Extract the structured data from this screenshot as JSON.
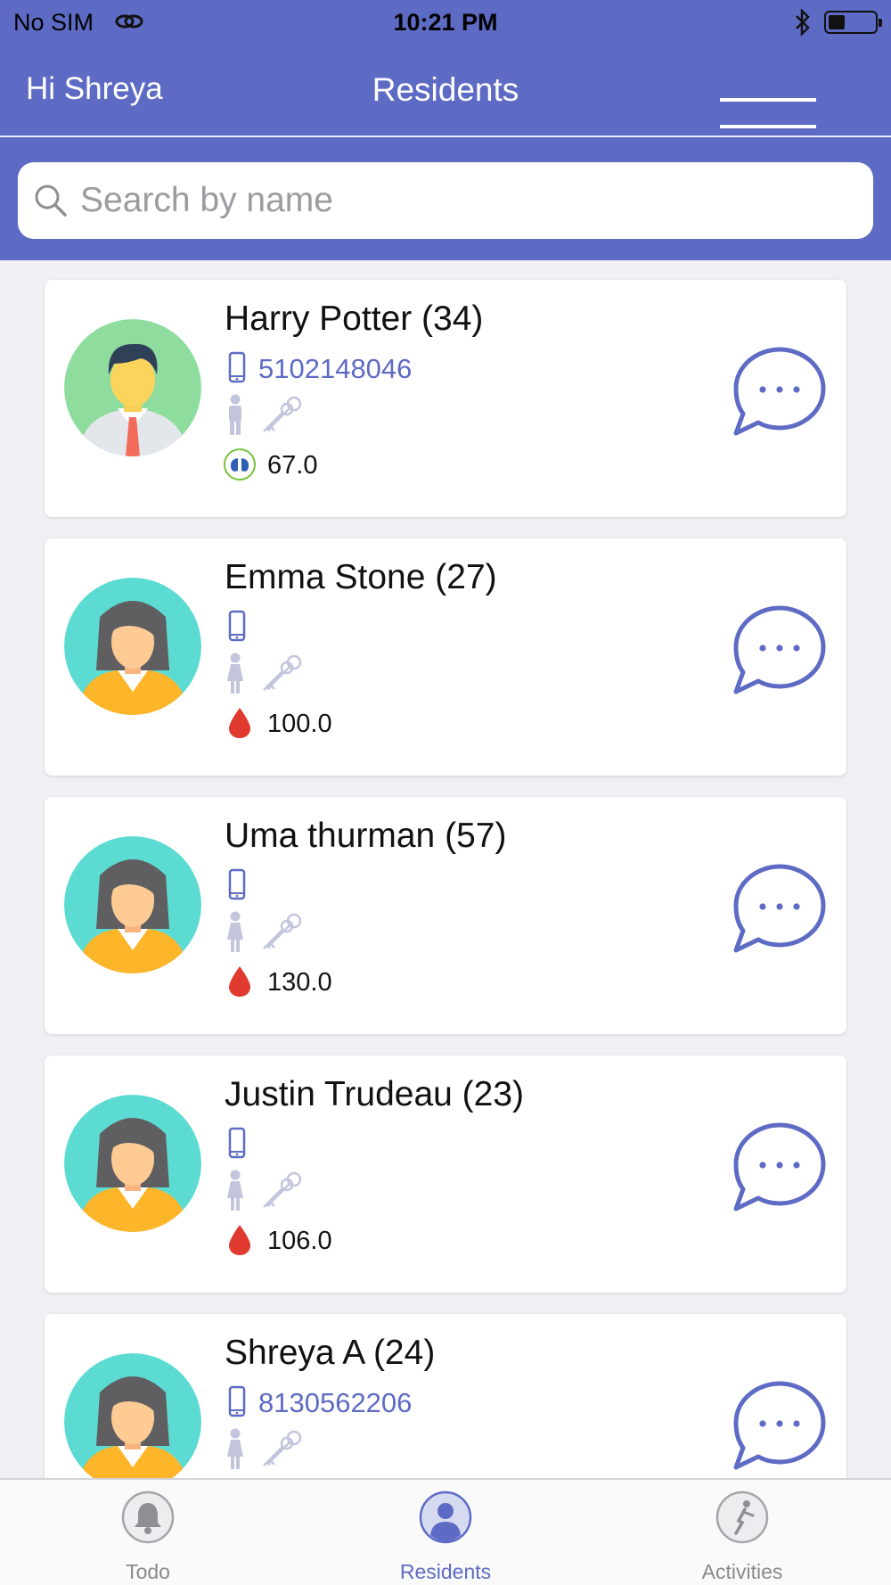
{
  "status_bar": {
    "carrier": "No SIM",
    "time": "10:21 PM",
    "wifi_icon": "wifi-icon",
    "bluetooth_icon": "bluetooth-icon",
    "battery_icon": "battery-icon"
  },
  "header": {
    "greeting": "Hi Shreya",
    "title": "Residents",
    "menu_icon": "hamburger-menu-icon"
  },
  "search": {
    "placeholder": "Search by name",
    "value": ""
  },
  "residents": [
    {
      "name": "Harry Potter (34)",
      "phone": "5102148046",
      "avatar": "male",
      "reading_icon": "lungs-icon",
      "reading": "67.0"
    },
    {
      "name": "Emma Stone (27)",
      "phone": "",
      "avatar": "female",
      "reading_icon": "blood-drop-icon",
      "reading": "100.0"
    },
    {
      "name": "Uma thurman (57)",
      "phone": "",
      "avatar": "female",
      "reading_icon": "blood-drop-icon",
      "reading": "130.0"
    },
    {
      "name": "Justin Trudeau (23)",
      "phone": "",
      "avatar": "female",
      "reading_icon": "blood-drop-icon",
      "reading": "106.0"
    },
    {
      "name": "Shreya A (24)",
      "phone": "8130562206",
      "avatar": "female",
      "reading_icon": "",
      "reading": ""
    }
  ],
  "tabs": [
    {
      "label": "Todo",
      "icon": "bell-icon",
      "active": false
    },
    {
      "label": "Residents",
      "icon": "person-icon",
      "active": true
    },
    {
      "label": "Activities",
      "icon": "activity-icon",
      "active": false
    }
  ],
  "colors": {
    "primary": "#5e6bc4",
    "background": "#efeff4",
    "drop": "#e03a2e",
    "male_avatar_bg": "#8edc9e",
    "female_avatar_bg": "#5cdbd3"
  }
}
